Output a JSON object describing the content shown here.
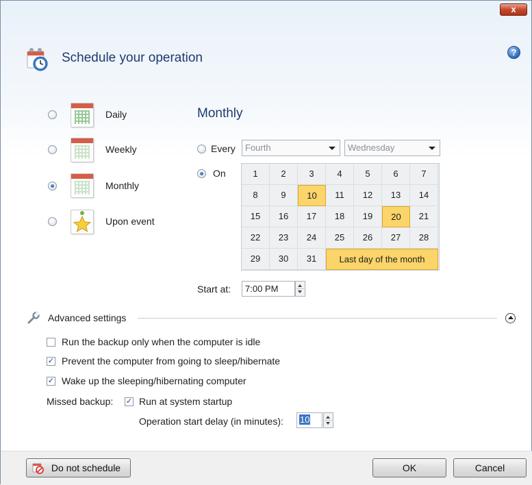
{
  "window": {
    "close_label": "x",
    "help_label": "?"
  },
  "header": {
    "title": "Schedule your operation"
  },
  "schedule_options": [
    {
      "label": "Daily",
      "selected": false,
      "icon": "daily-calendar-icon"
    },
    {
      "label": "Weekly",
      "selected": false,
      "icon": "weekly-calendar-icon"
    },
    {
      "label": "Monthly",
      "selected": true,
      "icon": "monthly-calendar-icon"
    },
    {
      "label": "Upon event",
      "selected": false,
      "icon": "star-event-icon"
    }
  ],
  "monthly": {
    "heading": "Monthly",
    "every": {
      "label": "Every",
      "selected": false,
      "ordinal_value": "Fourth",
      "weekday_value": "Wednesday"
    },
    "on": {
      "label": "On",
      "selected": true
    },
    "calendar": {
      "rows": [
        [
          "1",
          "2",
          "3",
          "4",
          "5",
          "6",
          "7"
        ],
        [
          "8",
          "9",
          "10",
          "11",
          "12",
          "13",
          "14"
        ],
        [
          "15",
          "16",
          "17",
          "18",
          "19",
          "20",
          "21"
        ],
        [
          "22",
          "23",
          "24",
          "25",
          "26",
          "27",
          "28"
        ],
        [
          "29",
          "30",
          "31"
        ]
      ],
      "selected_days": [
        "10",
        "20"
      ],
      "last_day_label": "Last day of the month",
      "last_day_selected": true
    },
    "start_at": {
      "label": "Start at:",
      "value": "7:00 PM"
    }
  },
  "advanced": {
    "title": "Advanced settings",
    "idle_label": "Run the backup only when the computer is idle",
    "idle_checked": false,
    "prevent_sleep_label": "Prevent the computer from going to sleep/hibernate",
    "prevent_sleep_checked": true,
    "wake_label": "Wake up the sleeping/hibernating computer",
    "wake_checked": true,
    "missed_label": "Missed backup:",
    "startup_label": "Run at system startup",
    "startup_checked": true,
    "delay_label": "Operation start delay (in minutes):",
    "delay_value": "10"
  },
  "footer": {
    "no_schedule_label": "Do not schedule",
    "ok_label": "OK",
    "cancel_label": "Cancel"
  },
  "colors": {
    "accent_title": "#1e3a6e",
    "calendar_selected": "#fbd46a",
    "close_button": "#c5472d"
  }
}
